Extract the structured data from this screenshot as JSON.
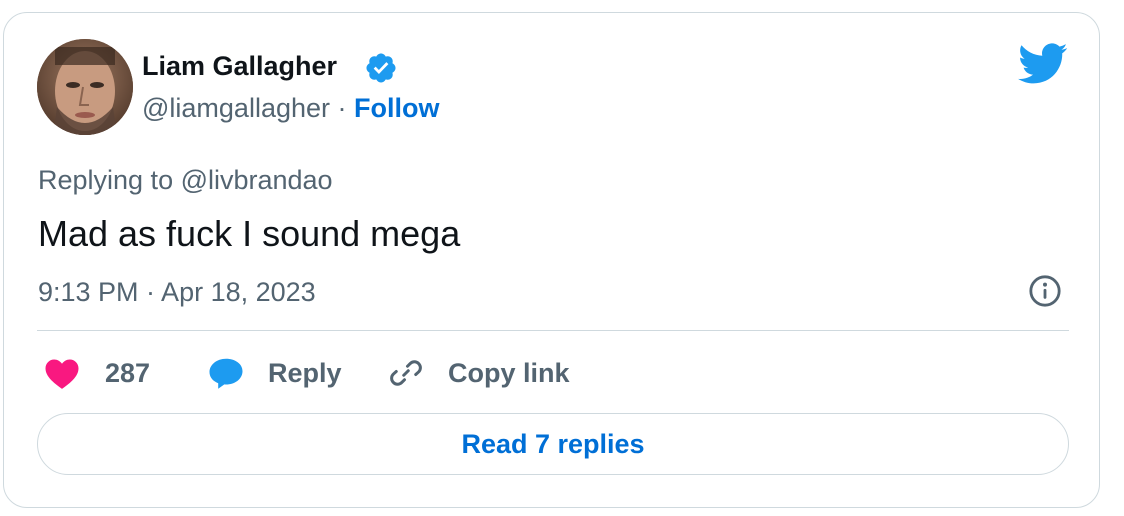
{
  "author": {
    "display_name": "Liam Gallagher",
    "handle": "@liamgallagher",
    "separator": "·",
    "follow_label": "Follow",
    "verified_icon": "verified-badge-icon",
    "avatar_icon": "profile-photo"
  },
  "brand": {
    "icon": "twitter-bird-icon",
    "color": "#1d9bf0"
  },
  "tweet": {
    "reply_to": "Replying to @livbrandao",
    "text": "Mad as fuck I sound mega",
    "timestamp": "9:13 PM · Apr 18, 2023"
  },
  "actions": {
    "like_count": "287",
    "reply_label": "Reply",
    "copy_label": "Copy link",
    "read_replies_label": "Read 7 replies"
  },
  "colors": {
    "like": "#f91880",
    "reply": "#1d9bf0",
    "link": "#006fd6",
    "muted": "#536471",
    "text": "#0f1419",
    "border": "#cfd9de"
  }
}
